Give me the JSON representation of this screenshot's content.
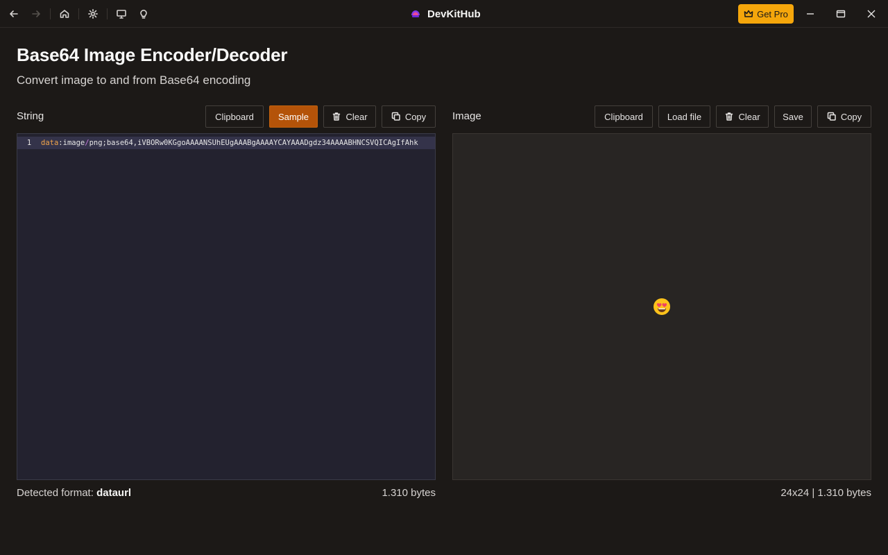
{
  "app": {
    "title": "DevKitHub",
    "get_pro_label": "Get Pro"
  },
  "titlebar": {
    "icons": [
      "back-icon",
      "forward-icon",
      "home-icon",
      "settings-icon",
      "monitor-icon",
      "lightbulb-icon"
    ],
    "window_controls": [
      "minimize-icon",
      "maximize-icon",
      "close-icon"
    ]
  },
  "page": {
    "title": "Base64 Image Encoder/Decoder",
    "subtitle": "Convert image to and from Base64 encoding"
  },
  "string_panel": {
    "label": "String",
    "buttons": {
      "clipboard": "Clipboard",
      "sample": "Sample",
      "clear": "Clear",
      "copy": "Copy"
    },
    "editor": {
      "line_number": "1",
      "token_key": "data",
      "token_colon": ":",
      "token_image": "image",
      "token_slash": "/",
      "token_rest": "png;base64,iVBORw0KGgoAAAANSUhEUgAAABgAAAAYCAYAAADgdz34AAAABHNCSVQICAgIfAhk"
    },
    "detected_format_label": "Detected format:",
    "detected_format_value": "dataurl",
    "size": "1.310 bytes"
  },
  "image_panel": {
    "label": "Image",
    "buttons": {
      "clipboard": "Clipboard",
      "load_file": "Load file",
      "clear": "Clear",
      "save": "Save",
      "copy": "Copy"
    },
    "preview_icon": "heart-eyes-emoji",
    "info": "24x24 | 1.310 bytes"
  },
  "colors": {
    "accent": "#b45309",
    "pro": "#f5a60b",
    "background": "#1c1917"
  }
}
